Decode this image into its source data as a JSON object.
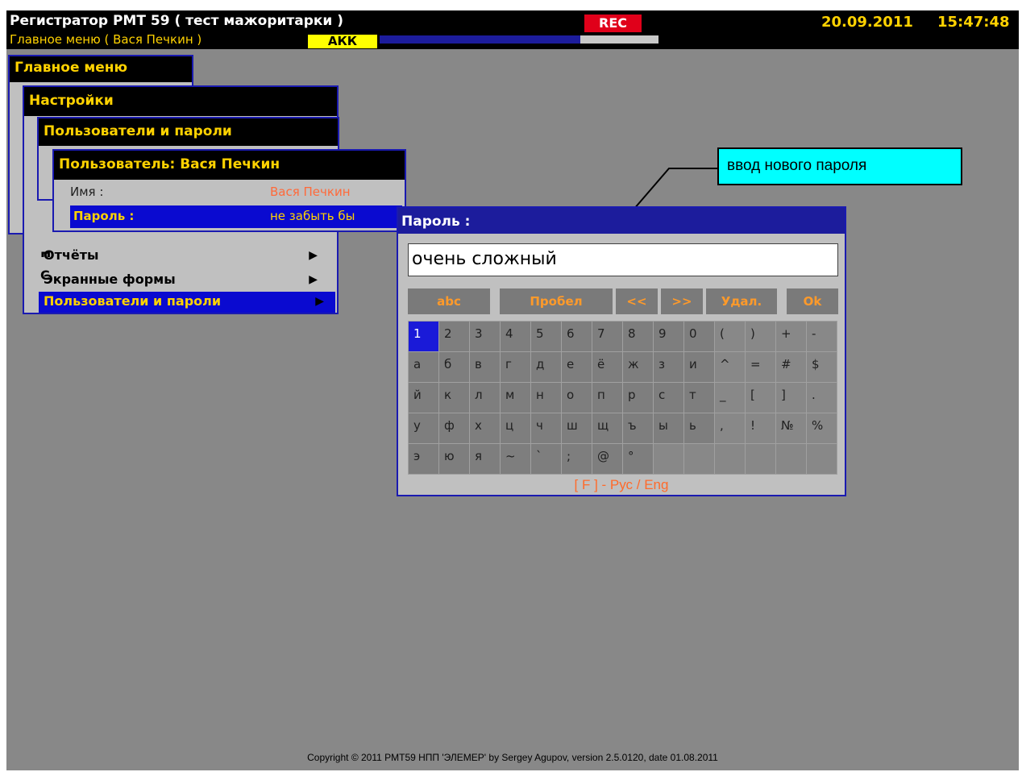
{
  "header": {
    "title": "Регистратор РМТ 59 ( тест мажоритарки )",
    "subtitle": "Главное меню ( Вася Печкин )",
    "rec": "REC",
    "akk": "АКК",
    "battery_level": 0.72,
    "date": "20.09.2011",
    "time": "15:47:48"
  },
  "menus": {
    "main_title": "Главное меню",
    "settings_title": "Настройки",
    "users_title": "Пользователи и пароли",
    "user_title": "Пользователь: Вася Печкин",
    "name_label": "Имя :",
    "name_value": "Вася Печкин",
    "password_label": "Пароль :",
    "password_value": "не забыть бы",
    "hidden_c": "С",
    "hidden_p": "П",
    "items": [
      {
        "label": "Отчёты"
      },
      {
        "label": "Экранные формы"
      },
      {
        "label": "Пользователи и пароли"
      }
    ]
  },
  "callout": {
    "text": "ввод нового пароля"
  },
  "dialog": {
    "title": "Пароль :",
    "input_value": "очень сложный",
    "buttons": {
      "abc": "abc",
      "space": "Пробел",
      "left": "<<",
      "right": ">>",
      "delete": "Удал.",
      "ok": "Ok"
    },
    "rows": [
      [
        "1",
        "2",
        "3",
        "4",
        "5",
        "6",
        "7",
        "8",
        "9",
        "0",
        "(",
        ")",
        "+",
        "-"
      ],
      [
        "а",
        "б",
        "в",
        "г",
        "д",
        "е",
        "ё",
        "ж",
        "з",
        "и",
        "^",
        "=",
        "#",
        "$"
      ],
      [
        "й",
        "к",
        "л",
        "м",
        "н",
        "о",
        "п",
        "р",
        "с",
        "т",
        "_",
        "[",
        "]",
        "."
      ],
      [
        "у",
        "ф",
        "х",
        "ц",
        "ч",
        "ш",
        "щ",
        "ъ",
        "ы",
        "ь",
        ",",
        "!",
        "№",
        "%"
      ],
      [
        "э",
        "ю",
        "я",
        "~",
        "`",
        ";",
        "@",
        "°",
        "",
        "",
        "",
        "",
        "",
        ""
      ]
    ],
    "hint": "[ F ] - Рус / Eng"
  },
  "footer": "Copyright © 2011 PMT59 НПП 'ЭЛЕМЕР' by Sergey Agupov, version 2.5.0120, date 01.08.2011"
}
